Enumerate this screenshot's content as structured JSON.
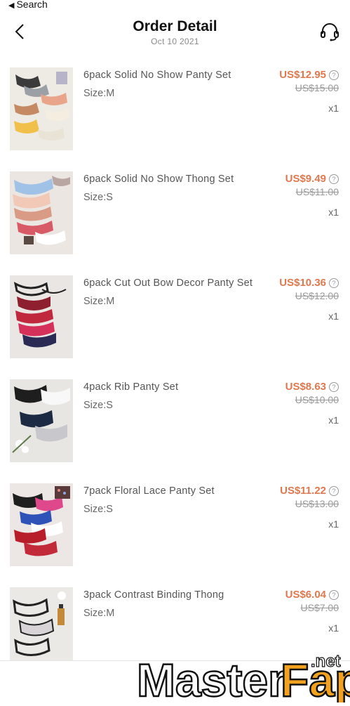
{
  "status": {
    "back_label": "Search"
  },
  "header": {
    "title": "Order Detail",
    "date": "Oct 10 2021"
  },
  "items": [
    {
      "name": "6pack Solid No Show Panty Set",
      "size": "Size:M",
      "price": "US$12.95",
      "original_price": "US$15.00",
      "quantity": "x1"
    },
    {
      "name": "6pack Solid No Show Thong Set",
      "size": "Size:S",
      "price": "US$9.49",
      "original_price": "US$11.00",
      "quantity": "x1"
    },
    {
      "name": "6pack Cut Out Bow Decor Panty Set",
      "size": "Size:M",
      "price": "US$10.36",
      "original_price": "US$12.00",
      "quantity": "x1"
    },
    {
      "name": "4pack Rib Panty Set",
      "size": "Size:S",
      "price": "US$8.63",
      "original_price": "US$10.00",
      "quantity": "x1"
    },
    {
      "name": "7pack Floral Lace Panty Set",
      "size": "Size:S",
      "price": "US$11.22",
      "original_price": "US$13.00",
      "quantity": "x1"
    },
    {
      "name": "3pack Contrast Binding Thong",
      "size": "Size:M",
      "price": "US$6.04",
      "original_price": "US$7.00",
      "quantity": "x1"
    }
  ],
  "watermark": {
    "text": "MasterFap",
    "suffix": ".net"
  },
  "colors": {
    "sale_price": "#e0784e",
    "strikethrough": "#9a9a9a"
  }
}
